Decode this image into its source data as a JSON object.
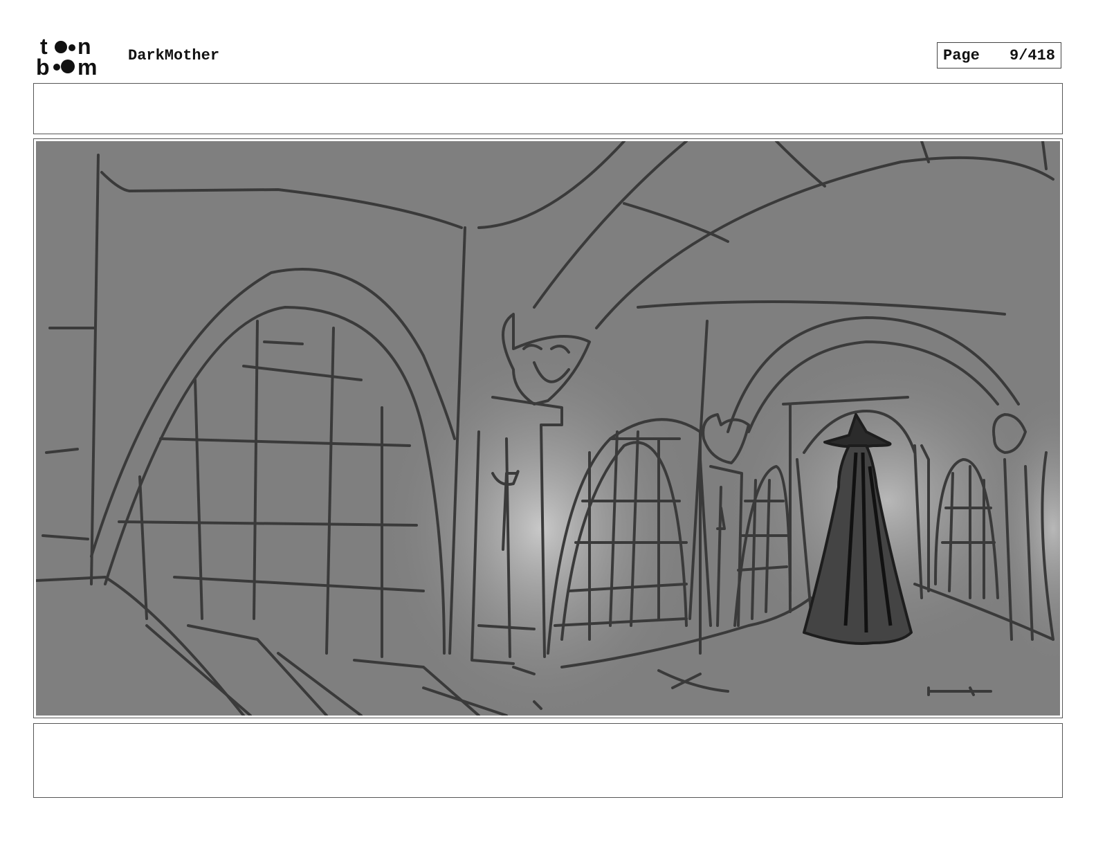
{
  "header": {
    "logo_text": "toon boom",
    "project_title": "DarkMother",
    "page_label": "Page",
    "page_number": "9/418"
  },
  "panel": {
    "action_notes": "",
    "dialogue_notes": ""
  },
  "colors": {
    "frame_gray": "#7f7f7f",
    "ink": "#3a3a3a",
    "figure": "#2b2b2b"
  }
}
